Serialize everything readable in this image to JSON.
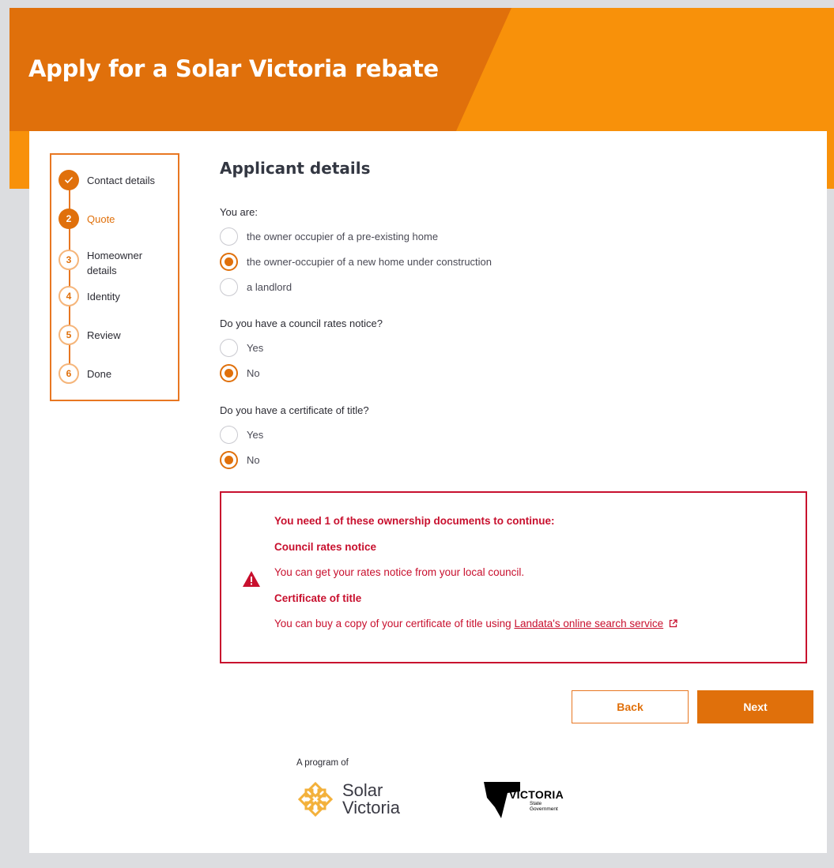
{
  "page": {
    "title": "Apply for a Solar Victoria rebate"
  },
  "stepper": {
    "steps": [
      {
        "number": "✓",
        "label": "Contact details",
        "state": "done"
      },
      {
        "number": "2",
        "label": "Quote",
        "state": "active"
      },
      {
        "number": "3",
        "label": "Homeowner details",
        "state": "pending"
      },
      {
        "number": "4",
        "label": "Identity",
        "state": "pending"
      },
      {
        "number": "5",
        "label": "Review",
        "state": "pending"
      },
      {
        "number": "6",
        "label": "Done",
        "state": "pending"
      }
    ]
  },
  "form": {
    "heading": "Applicant details",
    "q1": {
      "label": "You are:",
      "options": [
        {
          "label": "the owner occupier of a pre-existing home",
          "checked": false
        },
        {
          "label": "the owner-occupier of a new home under construction",
          "checked": true
        },
        {
          "label": "a landlord",
          "checked": false
        }
      ]
    },
    "q2": {
      "label": "Do you have a council rates notice?",
      "options": [
        {
          "label": "Yes",
          "checked": false
        },
        {
          "label": "No",
          "checked": true
        }
      ]
    },
    "q3": {
      "label": "Do you have a certificate of title?",
      "options": [
        {
          "label": "Yes",
          "checked": false
        },
        {
          "label": "No",
          "checked": true
        }
      ]
    }
  },
  "alert": {
    "title": "You need 1 of these ownership documents to continue:",
    "doc1_title": "Council rates notice",
    "doc1_text": "You can get your rates notice from your local council.",
    "doc2_title": "Certificate of title",
    "doc2_text": "You can buy a copy of your certificate of title using ",
    "doc2_link": "Landata's online search service",
    "icon": "warning-icon",
    "color": "#c8102e"
  },
  "actions": {
    "back_label": "Back",
    "next_label": "Next"
  },
  "footer": {
    "program_of": "A program of",
    "solar_line1": "Solar",
    "solar_line2": "Victoria",
    "vic_main": "VICTORIA",
    "vic_sub1": "State",
    "vic_sub2": "Government"
  },
  "colors": {
    "brand_orange": "#e0700b",
    "banner_light": "#f8910a",
    "error_red": "#c8102e"
  }
}
